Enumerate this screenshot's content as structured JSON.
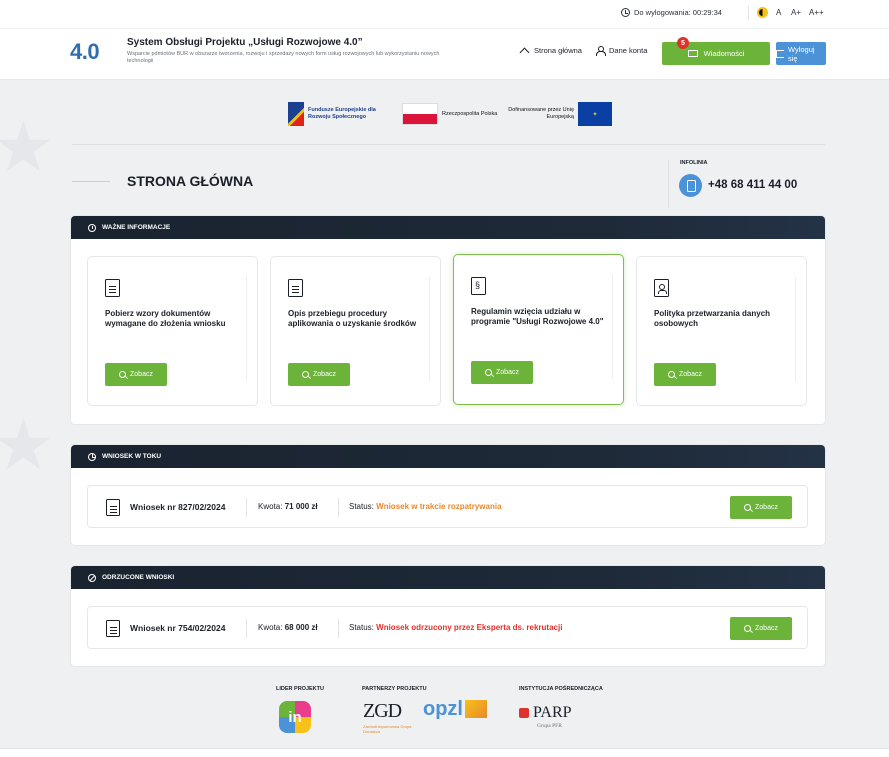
{
  "topbar": {
    "timer_label": "Do wylogowania: 00:29:34",
    "font_sizes": [
      "A",
      "A+",
      "A++"
    ]
  },
  "header": {
    "logo": "4.0",
    "title": "System Obsługi Projektu „Usługi Rozwojowe 4.0”",
    "subtitle": "Wsparcie pdmiotów BUR w obszarze tworzenia, rozwoju i sprzedaży nowych form usług rozwojowych lub wykorzystaniu nowych technologii",
    "nav_home": "Strona główna",
    "nav_account": "Dane konta",
    "messages_label": "Wiadomości",
    "messages_count": "5",
    "logout_label": "Wyloguj się"
  },
  "funding": {
    "fe": "Fundusze Europejskie dla Rozwoju Społecznego",
    "rp": "Rzeczpospolita Polska",
    "eu": "Dofinansowane przez Unię Europejską"
  },
  "page": {
    "title": "STRONA GŁÓWNA",
    "infolinia_label": "INFOLINIA",
    "phone": "+48 68 411 44 00"
  },
  "important": {
    "heading": "WAŻNE INFORMACJE",
    "cards": [
      {
        "text": "Pobierz wzory dokumentów wymagane do złożenia wniosku",
        "button": "Zobacz",
        "icon": "document-icon"
      },
      {
        "text": "Opis przebiegu procedury aplikowania o uzyskanie środków",
        "button": "Zobacz",
        "icon": "document-icon"
      },
      {
        "text": "Regulamin wzięcia udziału w programie \"Usługi Rozwojowe 4.0\"",
        "button": "Zobacz",
        "icon": "paragraph-document-icon"
      },
      {
        "text": "Polityka przetwarzania danych osobowych",
        "button": "Zobacz",
        "icon": "person-document-icon"
      }
    ]
  },
  "in_progress": {
    "heading": "WNIOSEK W TOKU",
    "number": "Wniosek nr 827/02/2024",
    "amount_label": "Kwota:",
    "amount": "71 000 zł",
    "status_label": "Status:",
    "status": "Wniosek w trakcie rozpatrywania",
    "button": "Zobacz"
  },
  "rejected": {
    "heading": "ODRZUCONE WNIOSKI",
    "number": "Wniosek nr 754/02/2024",
    "amount_label": "Kwota:",
    "amount": "68 000 zł",
    "status_label": "Status:",
    "status": "Wniosek odrzucony przez Eksperta ds. rekrutacji",
    "button": "Zobacz"
  },
  "footer": {
    "leader_label": "LIDER PROJEKTU",
    "partners_label": "PARTNERZY PROJEKTU",
    "institution_label": "INSTYTUCJA POŚREDNICZĄCA",
    "leader_logo": "in",
    "partner1": "ZGD",
    "partner1_sub": "Zachodniopomorska Grupa Doradcza",
    "partner2": "opzl",
    "institution": "PARP",
    "institution_sub": "Grupa PFR"
  },
  "colors": {
    "green": "#6cb33a",
    "blue": "#4b92d6",
    "dark": "#1a2330",
    "orange": "#e8892b",
    "red": "#e0322d"
  }
}
